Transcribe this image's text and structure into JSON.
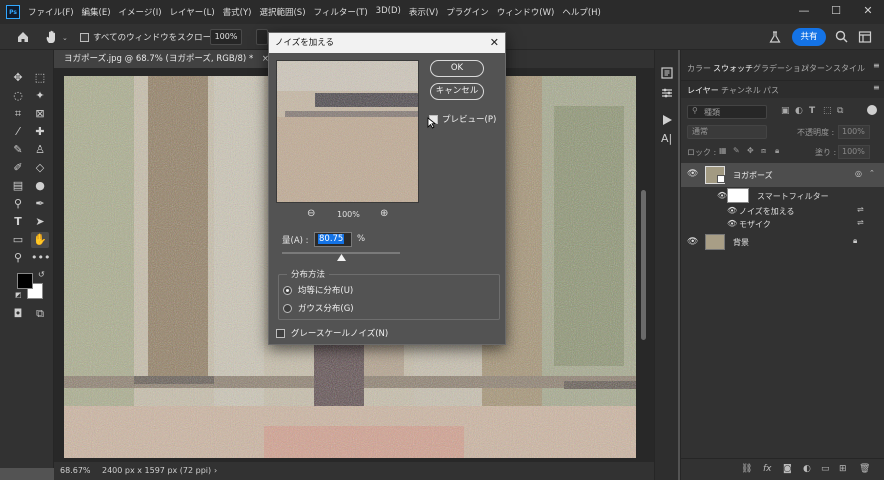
{
  "app": {
    "logo": "Ps"
  },
  "menu": [
    "ファイル(F)",
    "編集(E)",
    "イメージ(I)",
    "レイヤー(L)",
    "書式(Y)",
    "選択範囲(S)",
    "フィルター(T)",
    "3D(D)",
    "表示(V)",
    "プラグイン",
    "ウィンドウ(W)",
    "ヘルプ(H)"
  ],
  "window_controls": {
    "minimize": "—",
    "maximize": "☐",
    "close": "✕"
  },
  "options": {
    "scroll_all_label": "すべてのウィンドウをスクロール",
    "zoom": "100%",
    "share_label": "共有"
  },
  "document": {
    "tab_label": "ヨガポーズ.jpg @ 68.7% (ヨガポーズ, RGB/8) *",
    "tab_close": "×",
    "status_zoom": "68.67%",
    "status_info": "2400 px x 1597 px (72 ppi)",
    "status_arrow": "›"
  },
  "dialog": {
    "title": "ノイズを加える",
    "close": "✕",
    "ok_label": "OK",
    "cancel_label": "キャンセル",
    "preview_label": "プレビュー(P)",
    "preview_checked": true,
    "preview_zoom": "100%",
    "zoom_out": "⊖",
    "zoom_in": "⊕",
    "amount_label": "量(A) :",
    "amount_value": "80.75",
    "amount_unit": "%",
    "amount_slider_fraction": 0.5,
    "distribution_legend": "分布方法",
    "uniform_label": "均等に分布(U)",
    "uniform_checked": true,
    "gaussian_label": "ガウス分布(G)",
    "gaussian_checked": false,
    "grayscale_label": "グレースケールノイズ(N)",
    "grayscale_checked": false
  },
  "panels": {
    "top_tabs": [
      "カラー",
      "スウォッチ",
      "グラデーション",
      "パターン",
      "スタイル"
    ],
    "top_active": "スウォッチ",
    "layer_tabs": [
      "レイヤー",
      "チャンネル",
      "パス"
    ],
    "layer_active": "レイヤー",
    "search_placeholder": "種類",
    "blend_mode": "通常",
    "opacity_label": "不透明度 :",
    "opacity_value": "100%",
    "lock_label": "ロック :",
    "fill_label": "塗り :",
    "fill_value": "100%",
    "layers": [
      {
        "name": "ヨガポーズ",
        "type": "smart",
        "visible": true,
        "selected": true
      },
      {
        "name": "スマートフィルター",
        "type": "filter-mask",
        "visible": true
      },
      {
        "name": "ノイズを加える",
        "type": "filter",
        "visible": true
      },
      {
        "name": "モザイク",
        "type": "filter",
        "visible": true
      },
      {
        "name": "背景",
        "type": "background",
        "visible": true,
        "locked": true
      }
    ]
  },
  "colors": {
    "accent": "#1473e6",
    "foreground": "#000000",
    "background": "#ffffff"
  }
}
